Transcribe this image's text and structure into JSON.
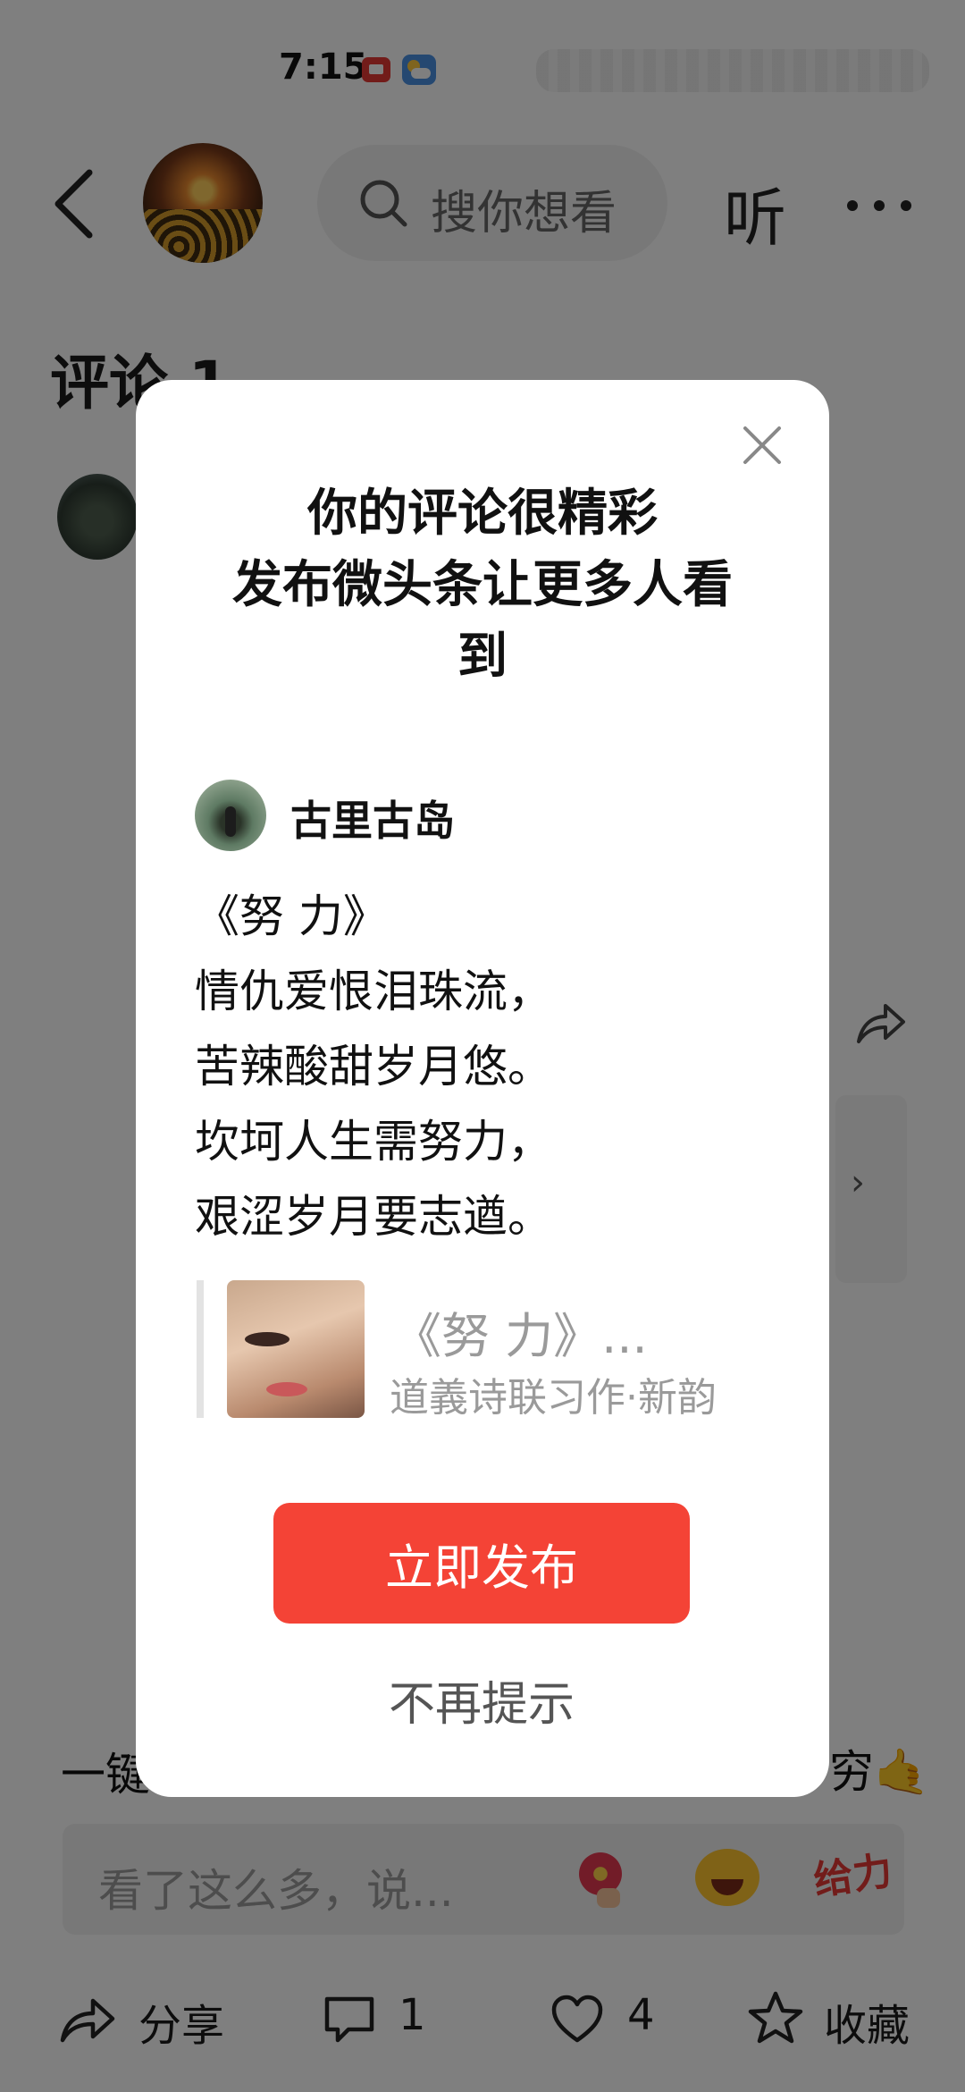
{
  "status_bar": {
    "time": "7:15"
  },
  "header": {
    "search_placeholder": "搜你想看",
    "listen_label": "听"
  },
  "comments": {
    "title": "评论 1"
  },
  "background": {
    "notice_left": "一键",
    "notice_right": "穷🤙",
    "comment_placeholder": "看了这么多，说...",
    "geili_label": "给力"
  },
  "bottom_bar": {
    "share_label": "分享",
    "comment_count": "1",
    "like_count": "4",
    "favorite_label": "收藏"
  },
  "dialog": {
    "title_lines": [
      "你的评论很精彩",
      "发布微头条让更多人看",
      "到"
    ],
    "author_name": "古里古岛",
    "poem_lines": [
      "《努 力》",
      "情仇爱恨泪珠流，",
      "苦辣酸甜岁月悠。",
      "坎坷人生需努力，",
      "艰涩岁月要志遒。"
    ],
    "article_title": "《努 力》...",
    "article_subtitle": "道義诗联习作·新韵",
    "publish_button": "立即发布",
    "dismiss_text": "不再提示"
  },
  "colors": {
    "accent": "#f44336",
    "overlay": "rgba(0,0,0,0.5)"
  }
}
